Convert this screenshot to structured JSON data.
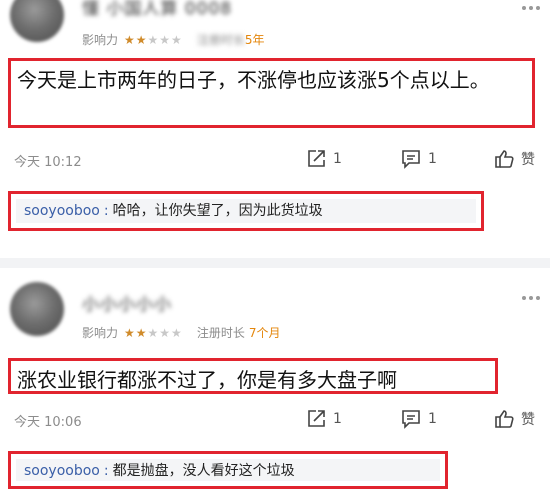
{
  "posts": [
    {
      "username": "懂 小国人算 0008",
      "influence_label": "影响力",
      "stars_on": "★★",
      "stars_off": "★★★",
      "reg_label": "注册时长",
      "reg_value": "5年",
      "content": "今天是上市两年的日子，不涨停也应该涨5个点以上。",
      "time": "今天 10:12",
      "share_count": "1",
      "comment_count": "1",
      "like_label": "赞",
      "reply": {
        "user": "sooyooboo",
        "colon": ":",
        "text": "哈哈，让你失望了，因为此货垃圾"
      }
    },
    {
      "username": "小小小小小",
      "influence_label": "影响力",
      "stars_on": "★★",
      "stars_off": "★★★",
      "reg_label": "注册时长",
      "reg_value": "7个月",
      "content": "涨农业银行都涨不过了，你是有多大盘子啊",
      "time": "今天 10:06",
      "share_count": "1",
      "comment_count": "1",
      "like_label": "赞",
      "reply": {
        "user": "sooyooboo",
        "colon": ":",
        "text": "都是抛盘，没人看好这个垃圾"
      }
    }
  ],
  "icons": {
    "more": "more-dots-icon",
    "share": "share-icon",
    "comment": "comment-icon",
    "like": "thumbs-up-icon"
  },
  "colors": {
    "highlight": "#e1242e",
    "reply_user": "#3a5fa8",
    "reg_value": "#e4870d",
    "stars": "#d08b2b"
  }
}
